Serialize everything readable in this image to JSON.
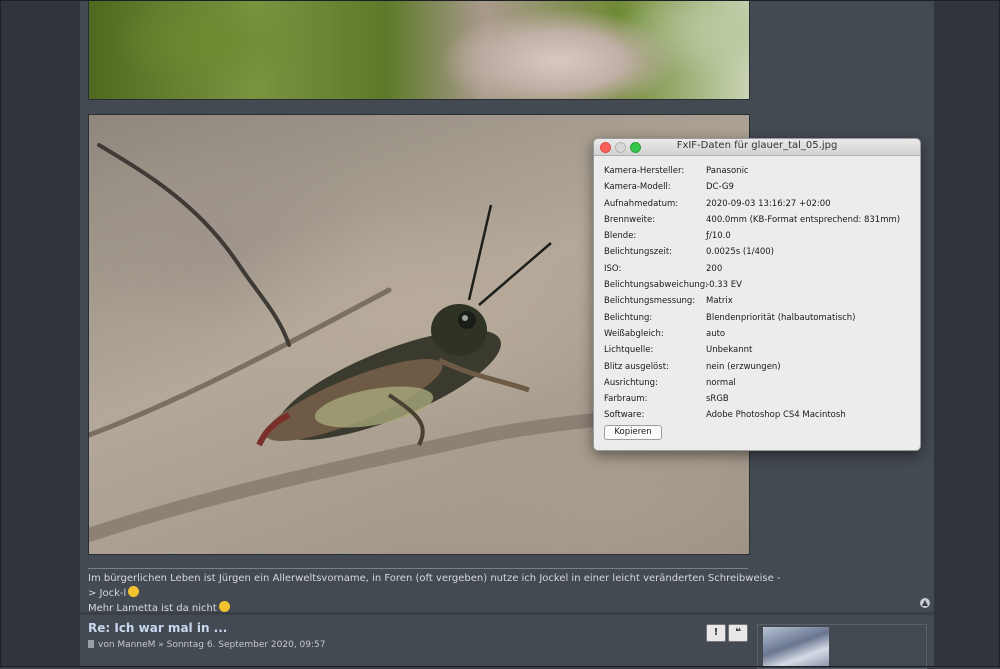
{
  "dialog": {
    "title": "FxIF-Daten für glauer_tal_05.jpg",
    "copy_label": "Kopieren",
    "rows": [
      {
        "label": "Kamera-Hersteller:",
        "value": "Panasonic"
      },
      {
        "label": "Kamera-Modell:",
        "value": "DC-G9"
      },
      {
        "label": "Aufnahmedatum:",
        "value": "2020-09-03 13:16:27 +02:00"
      },
      {
        "label": "Brennweite:",
        "value": "400.0mm (KB-Format entsprechend: 831mm)"
      },
      {
        "label": "Blende:",
        "value": "ƒ/10.0"
      },
      {
        "label": "Belichtungszeit:",
        "value": "0.0025s (1/400)"
      },
      {
        "label": "ISO:",
        "value": "200"
      },
      {
        "label": "Belichtungsabweichung:",
        "value": "-0.33 EV"
      },
      {
        "label": "Belichtungsmessung:",
        "value": "Matrix"
      },
      {
        "label": "Belichtung:",
        "value": "Blendenpriorität (halbautomatisch)"
      },
      {
        "label": "Weißabgleich:",
        "value": "auto"
      },
      {
        "label": "Lichtquelle:",
        "value": "Unbekannt"
      },
      {
        "label": "Blitz ausgelöst:",
        "value": "nein (erzwungen)"
      },
      {
        "label": "Ausrichtung:",
        "value": "normal"
      },
      {
        "label": "Farbraum:",
        "value": "sRGB"
      },
      {
        "label": "Software:",
        "value": "Adobe Photoshop CS4 Macintosh"
      }
    ]
  },
  "signature": {
    "line1": "Im bürgerlichen Leben ist Jürgen ein Allerweltsvorname, in Foren (oft vergeben) nutze ich Jockel in einer leicht veränderten Schreibweise -> Jock-l",
    "line2": "Mehr Lametta ist da nicht"
  },
  "reply": {
    "title": "Re: Ich war mal in ...",
    "meta": "von ManneM » Sonntag 6. September 2020, 09:57",
    "report_label": "!",
    "quote_label": "❝"
  },
  "colors": {
    "page_bg": "#3a3f47",
    "panel_bg": "#444a52",
    "link_color": "#c9d7f0"
  }
}
